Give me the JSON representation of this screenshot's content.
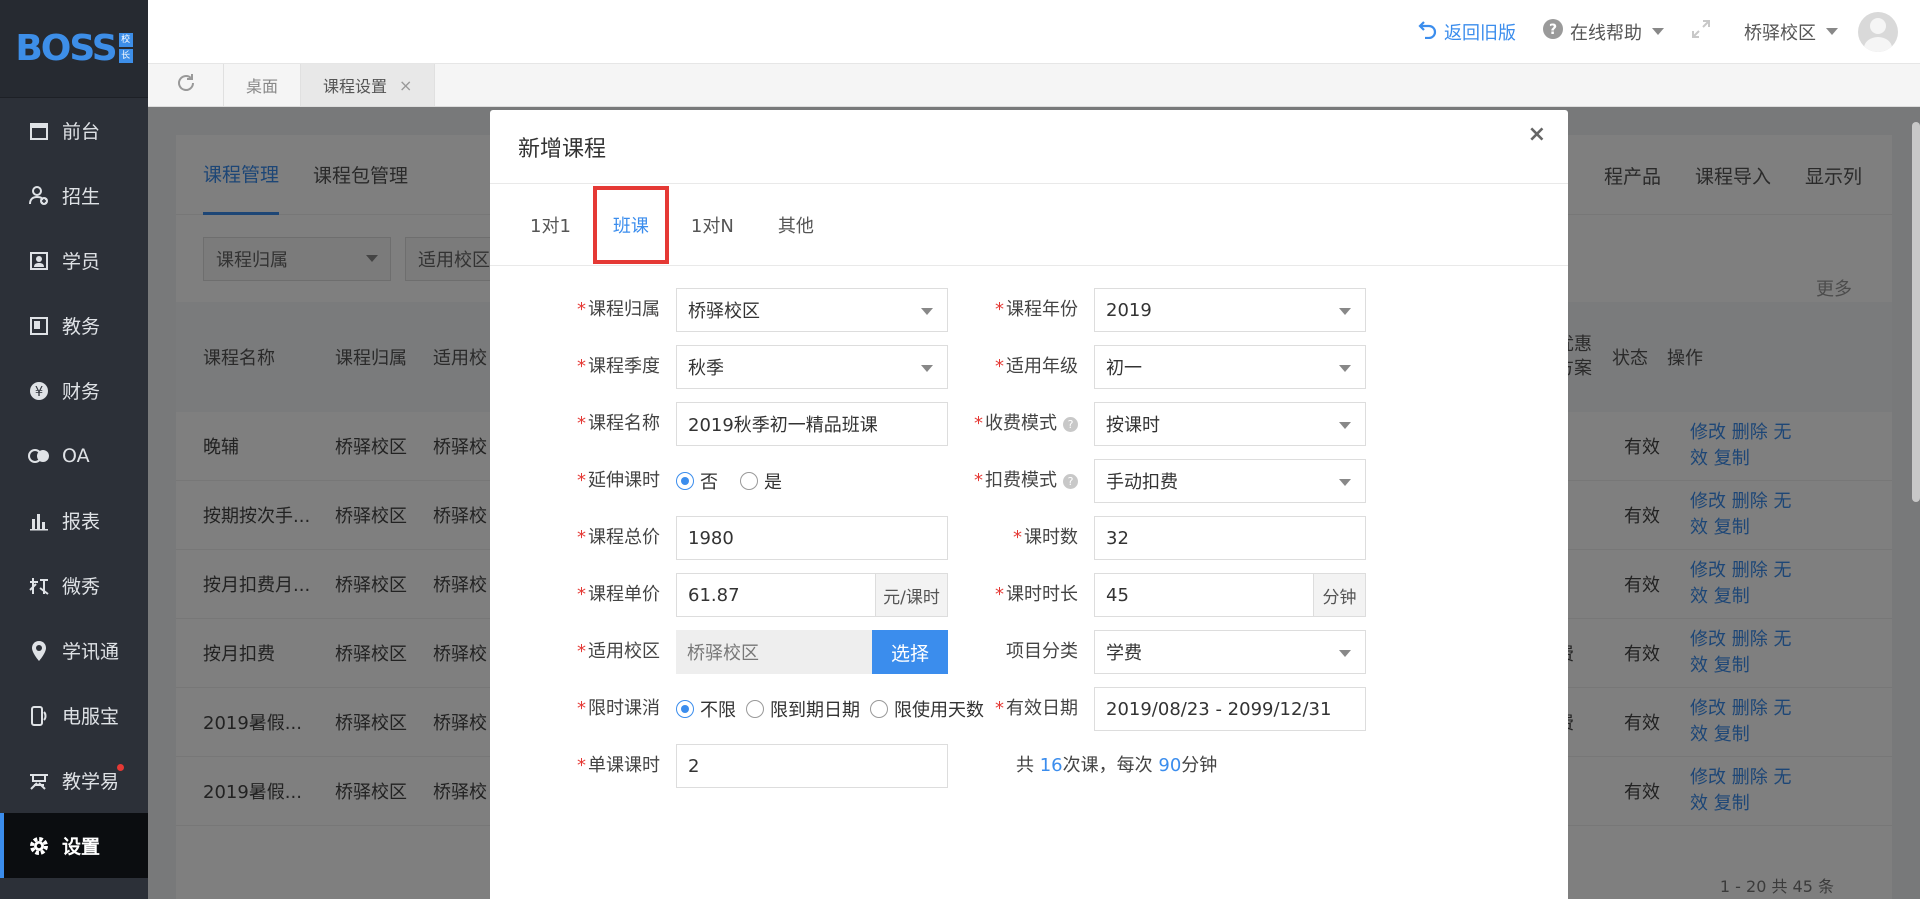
{
  "app": {
    "logo": "BOSS",
    "logo_badge": [
      "校",
      "长"
    ]
  },
  "sidebar": {
    "items": [
      {
        "label": "前台",
        "icon": "calendar-icon"
      },
      {
        "label": "招生",
        "icon": "user-add-icon"
      },
      {
        "label": "学员",
        "icon": "student-card-icon"
      },
      {
        "label": "教务",
        "icon": "book-icon"
      },
      {
        "label": "财务",
        "icon": "yen-icon"
      },
      {
        "label": "OA",
        "icon": "oa-icon"
      },
      {
        "label": "报表",
        "icon": "bar-chart-icon"
      },
      {
        "label": "微秀",
        "icon": "weixiu-icon"
      },
      {
        "label": "学讯通",
        "icon": "location-pin-icon"
      },
      {
        "label": "电服宝",
        "icon": "phone-icon"
      },
      {
        "label": "教学易",
        "icon": "teaching-icon"
      },
      {
        "label": "设置",
        "icon": "gear-icon"
      }
    ],
    "active_index": 11
  },
  "header": {
    "back_old": "返回旧版",
    "help": "在线帮助",
    "campus": "桥驿校区"
  },
  "page_tabs": {
    "items": [
      "桌面",
      "课程设置"
    ],
    "close": "×"
  },
  "background": {
    "tabs": [
      "课程管理",
      "课程包管理"
    ],
    "right_actions": [
      "程产品",
      "课程导入",
      "显示列"
    ],
    "filters": [
      "课程归属",
      "适用校区"
    ],
    "more": "更多",
    "columns": {
      "name": "课程名称",
      "owner": "课程归属",
      "campus": "适用校",
      "discount": "优惠方案",
      "status": "状态",
      "ops": "操作"
    },
    "rows": [
      {
        "name": "晚辅",
        "owner": "桥驿校区",
        "campus": "桥驿校",
        "extra": "..",
        "status": "有效"
      },
      {
        "name": "按期按次手...",
        "owner": "桥驿校区",
        "campus": "桥驿校",
        "extra": "",
        "status": "有效"
      },
      {
        "name": "按月扣费月...",
        "owner": "桥驿校区",
        "campus": "桥驿校",
        "extra": "..",
        "status": "有效"
      },
      {
        "name": "按月扣费",
        "owner": "桥驿校区",
        "campus": "桥驿校",
        "extra": "费",
        "status": "有效"
      },
      {
        "name": "2019暑假...",
        "owner": "桥驿校区",
        "campus": "桥驿校",
        "extra": "费",
        "status": "有效"
      },
      {
        "name": "2019暑假...",
        "owner": "桥驿校区",
        "campus": "桥驿校",
        "extra": "",
        "status": "有效"
      }
    ],
    "ops": {
      "line1": "修改 删除 无",
      "line2": "效 复制"
    },
    "pagination": "1 - 20   共 45 条"
  },
  "modal": {
    "title": "新增课程",
    "close": "×",
    "tabs": [
      "1对1",
      "班课",
      "1对N",
      "其他"
    ],
    "active_tab": 1,
    "fields": {
      "owner_label": "课程归属",
      "owner_value": "桥驿校区",
      "year_label": "课程年份",
      "year_value": "2019",
      "season_label": "课程季度",
      "season_value": "秋季",
      "grade_label": "适用年级",
      "grade_value": "初一",
      "name_label": "课程名称",
      "name_value": "2019秋季初一精品班课",
      "charge_label": "收费模式",
      "charge_value": "按课时",
      "extend_label": "延伸课时",
      "extend_no": "否",
      "extend_yes": "是",
      "deduct_label": "扣费模式",
      "deduct_value": "手动扣费",
      "total_label": "课程总价",
      "total_value": "1980",
      "hours_label": "课时数",
      "hours_value": "32",
      "unit_label": "课程单价",
      "unit_value": "61.87",
      "unit_suffix": "元/课时",
      "duration_label": "课时时长",
      "duration_value": "45",
      "duration_suffix": "分钟",
      "campus_label": "适用校区",
      "campus_value": "桥驿校区",
      "campus_button": "选择",
      "category_label": "项目分类",
      "category_value": "学费",
      "limit_label": "限时课消",
      "limit_opt1": "不限",
      "limit_opt2": "限到期日期",
      "limit_opt3": "限使用天数",
      "valid_label": "有效日期",
      "valid_value": "2019/08/23 - 2099/12/31",
      "single_label": "单课课时",
      "single_value": "2",
      "summary_prefix": "共 ",
      "summary_count": "16",
      "summary_mid": "次课，每次 ",
      "summary_minutes": "90",
      "summary_suffix": "分钟"
    }
  },
  "colors": {
    "accent": "#3b8ded",
    "sidebar": "#2c3038",
    "highlight": "#e53935"
  }
}
